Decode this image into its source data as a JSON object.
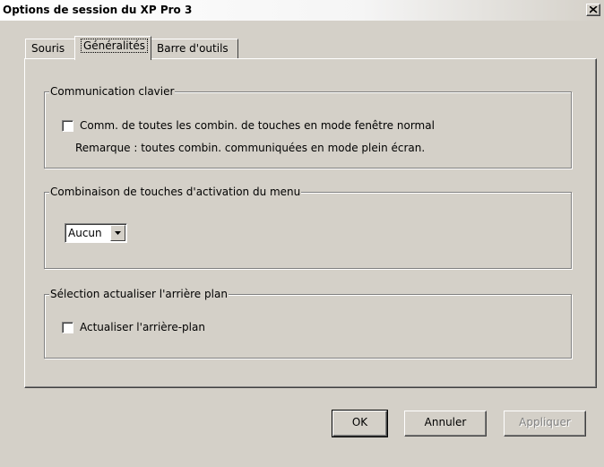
{
  "window": {
    "title": "Options de session du XP Pro 3",
    "close_glyph": "close-icon"
  },
  "tabs": [
    {
      "label": "Souris",
      "active": false
    },
    {
      "label": "Généralités",
      "active": true
    },
    {
      "label": "Barre d'outils",
      "active": false
    }
  ],
  "groups": {
    "keyboard": {
      "title": "Communication clavier",
      "checkbox_label": "Comm. de toutes les combin. de touches en mode fenêtre normal",
      "checked": false,
      "note": "Remarque : toutes combin. communiquées en mode plein écran."
    },
    "menu_keys": {
      "title": "Combinaison de touches d'activation du menu",
      "selected": "Aucun"
    },
    "background": {
      "title": "Sélection actualiser l'arrière plan",
      "checkbox_label": "Actualiser l'arrière-plan",
      "checked": false
    }
  },
  "buttons": {
    "ok": "OK",
    "cancel": "Annuler",
    "apply": "Appliquer",
    "apply_enabled": false
  },
  "colors": {
    "dialog_bg": "#d4d0c8",
    "disabled_text": "#808080"
  }
}
